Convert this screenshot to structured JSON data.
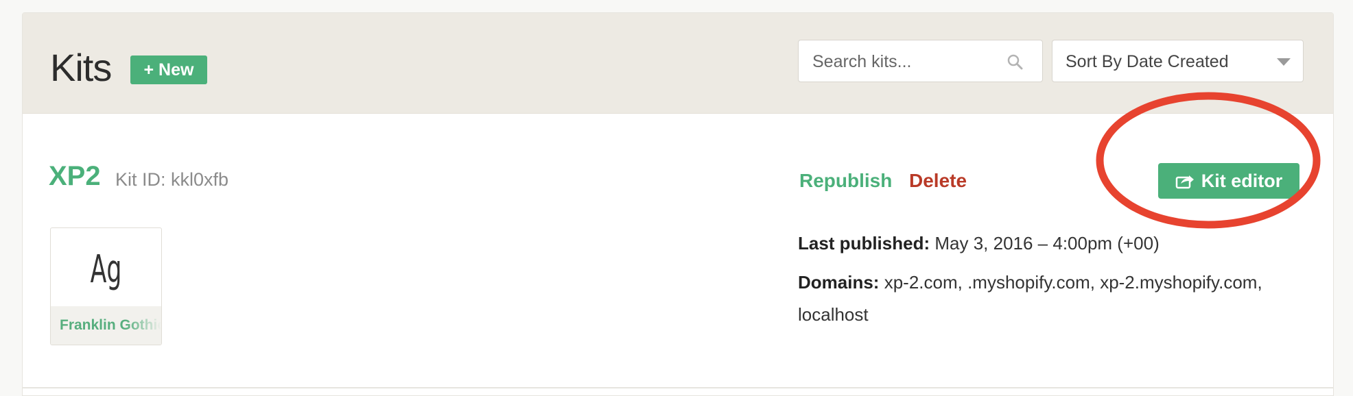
{
  "header": {
    "title": "Kits",
    "new_button": "+ New",
    "search_placeholder": "Search kits...",
    "sort_selected": "Sort By Date Created"
  },
  "kit": {
    "name": "XP2",
    "id_label": "Kit ID: kkl0xfb",
    "republish": "Republish",
    "delete": "Delete",
    "editor_button": "Kit editor",
    "font_sample": "Ag",
    "font_name": "Franklin Gothic",
    "last_published_label": "Last published:",
    "last_published_value": "May 3, 2016 – 4:00pm (+00)",
    "domains_label": "Domains:",
    "domains_value": "xp-2.com, .myshopify.com, xp-2.myshopify.com, localhost"
  },
  "colors": {
    "accent": "#4bb07a",
    "danger": "#b93a27",
    "annotation": "#e7432f"
  },
  "icons": {
    "search": "search-icon",
    "sort_toggle": "chevron-down-icon",
    "editor": "share-icon"
  }
}
